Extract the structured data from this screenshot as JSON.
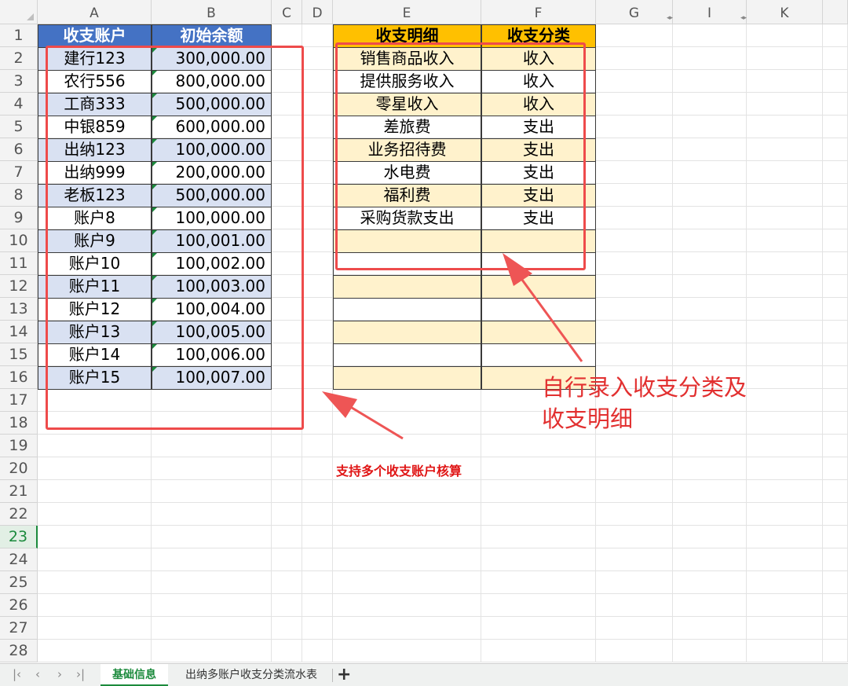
{
  "columns": [
    "A",
    "B",
    "C",
    "D",
    "E",
    "F",
    "G",
    "I",
    "K"
  ],
  "rows": [
    "1",
    "2",
    "3",
    "4",
    "5",
    "6",
    "7",
    "8",
    "9",
    "10",
    "11",
    "12",
    "13",
    "14",
    "15",
    "16",
    "17",
    "18",
    "19",
    "20",
    "21",
    "22",
    "23",
    "24",
    "25",
    "26",
    "27",
    "28"
  ],
  "selected_row": "23",
  "accounts": {
    "header_account": "收支账户",
    "header_balance": "初始余额",
    "items": [
      {
        "name": "建行123",
        "balance": "300,000.00"
      },
      {
        "name": "农行556",
        "balance": "800,000.00"
      },
      {
        "name": "工商333",
        "balance": "500,000.00"
      },
      {
        "name": "中银859",
        "balance": "600,000.00"
      },
      {
        "name": "出纳123",
        "balance": "100,000.00"
      },
      {
        "name": "出纳999",
        "balance": "200,000.00"
      },
      {
        "name": "老板123",
        "balance": "500,000.00"
      },
      {
        "name": "账户8",
        "balance": "100,000.00"
      },
      {
        "name": "账户9",
        "balance": "100,001.00"
      },
      {
        "name": "账户10",
        "balance": "100,002.00"
      },
      {
        "name": "账户11",
        "balance": "100,003.00"
      },
      {
        "name": "账户12",
        "balance": "100,004.00"
      },
      {
        "name": "账户13",
        "balance": "100,005.00"
      },
      {
        "name": "账户14",
        "balance": "100,006.00"
      },
      {
        "name": "账户15",
        "balance": "100,007.00"
      }
    ]
  },
  "categories": {
    "header_detail": "收支明细",
    "header_type": "收支分类",
    "items": [
      {
        "detail": "销售商品收入",
        "type": "收入"
      },
      {
        "detail": "提供服务收入",
        "type": "收入"
      },
      {
        "detail": "零星收入",
        "type": "收入"
      },
      {
        "detail": "差旅费",
        "type": "支出"
      },
      {
        "detail": "业务招待费",
        "type": "支出"
      },
      {
        "detail": "水电费",
        "type": "支出"
      },
      {
        "detail": "福利费",
        "type": "支出"
      },
      {
        "detail": "采购货款支出",
        "type": "支出"
      },
      {
        "detail": "",
        "type": ""
      },
      {
        "detail": "",
        "type": ""
      },
      {
        "detail": "",
        "type": ""
      },
      {
        "detail": "",
        "type": ""
      },
      {
        "detail": "",
        "type": ""
      },
      {
        "detail": "",
        "type": ""
      },
      {
        "detail": "",
        "type": ""
      }
    ]
  },
  "annotations": {
    "right_line1": "自行录入收支分类及",
    "right_line2": "收支明细",
    "left_note": "支持多个收支账户核算"
  },
  "sheet_tabs": {
    "active": "基础信息",
    "other": "出纳多账户收支分类流水表",
    "add": "+"
  },
  "nav_icons": [
    "first-sheet-icon",
    "prev-sheet-icon",
    "next-sheet-icon",
    "last-sheet-icon"
  ],
  "colors": {
    "account_header": "#4472c4",
    "account_band": "#d9e1f2",
    "category_header": "#ffc000",
    "category_band": "#fff2cc",
    "annotation_red": "#ee4b4b",
    "active_tab": "#1b8a3c"
  }
}
